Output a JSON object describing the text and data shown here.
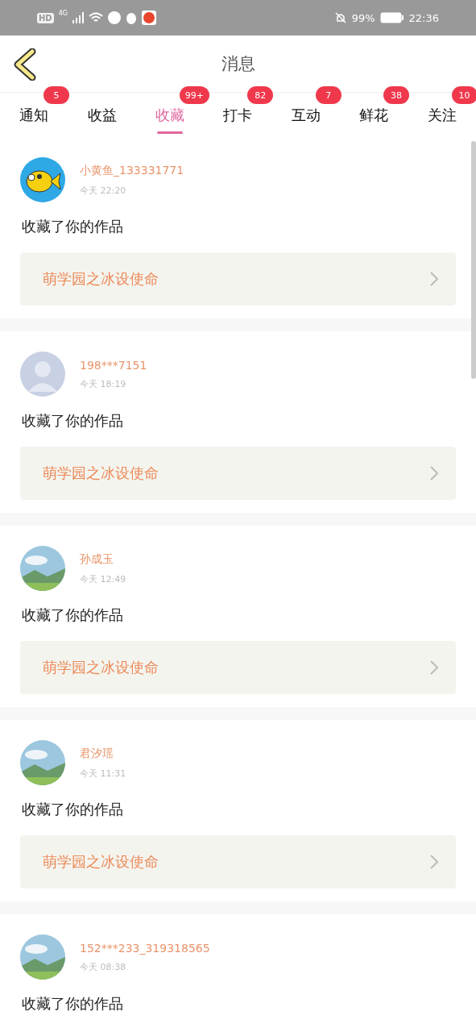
{
  "status_bar": {
    "hd": "HD",
    "network": "4G",
    "battery": "99%",
    "time": "22:36"
  },
  "header": {
    "title": "消息"
  },
  "tabs": [
    {
      "label": "通知",
      "badge": "5",
      "selected": false
    },
    {
      "label": "收益",
      "selected": false
    },
    {
      "label": "收藏",
      "badge": "99+",
      "selected": true
    },
    {
      "label": "打卡",
      "badge": "82",
      "selected": false
    },
    {
      "label": "互动",
      "badge": "7",
      "selected": false
    },
    {
      "label": "鲜花",
      "badge": "38",
      "selected": false
    },
    {
      "label": "关注",
      "badge": "10",
      "selected": false
    }
  ],
  "messages": [
    {
      "avatar": {
        "kind": "fish"
      },
      "name": "小黄鱼_133331771",
      "time": "今天 22:20",
      "text": "收藏了你的作品",
      "work": "萌学园之冰设使命"
    },
    {
      "avatar": {
        "kind": "default"
      },
      "name": "198***7151",
      "time": "今天 18:19",
      "text": "收藏了你的作品",
      "work": "萌学园之冰设使命"
    },
    {
      "name": "孙成玉",
      "time": "今天 12:49",
      "text": "收藏了你的作品",
      "work": "萌学园之冰设使命"
    },
    {
      "name": "君汐瑶",
      "time": "今天 11:31",
      "text": "收藏了你的作品",
      "work": "萌学园之冰设使命"
    },
    {
      "name": "152***233_319318565",
      "time": "今天 08:38",
      "text": "收藏了你的作品"
    }
  ]
}
